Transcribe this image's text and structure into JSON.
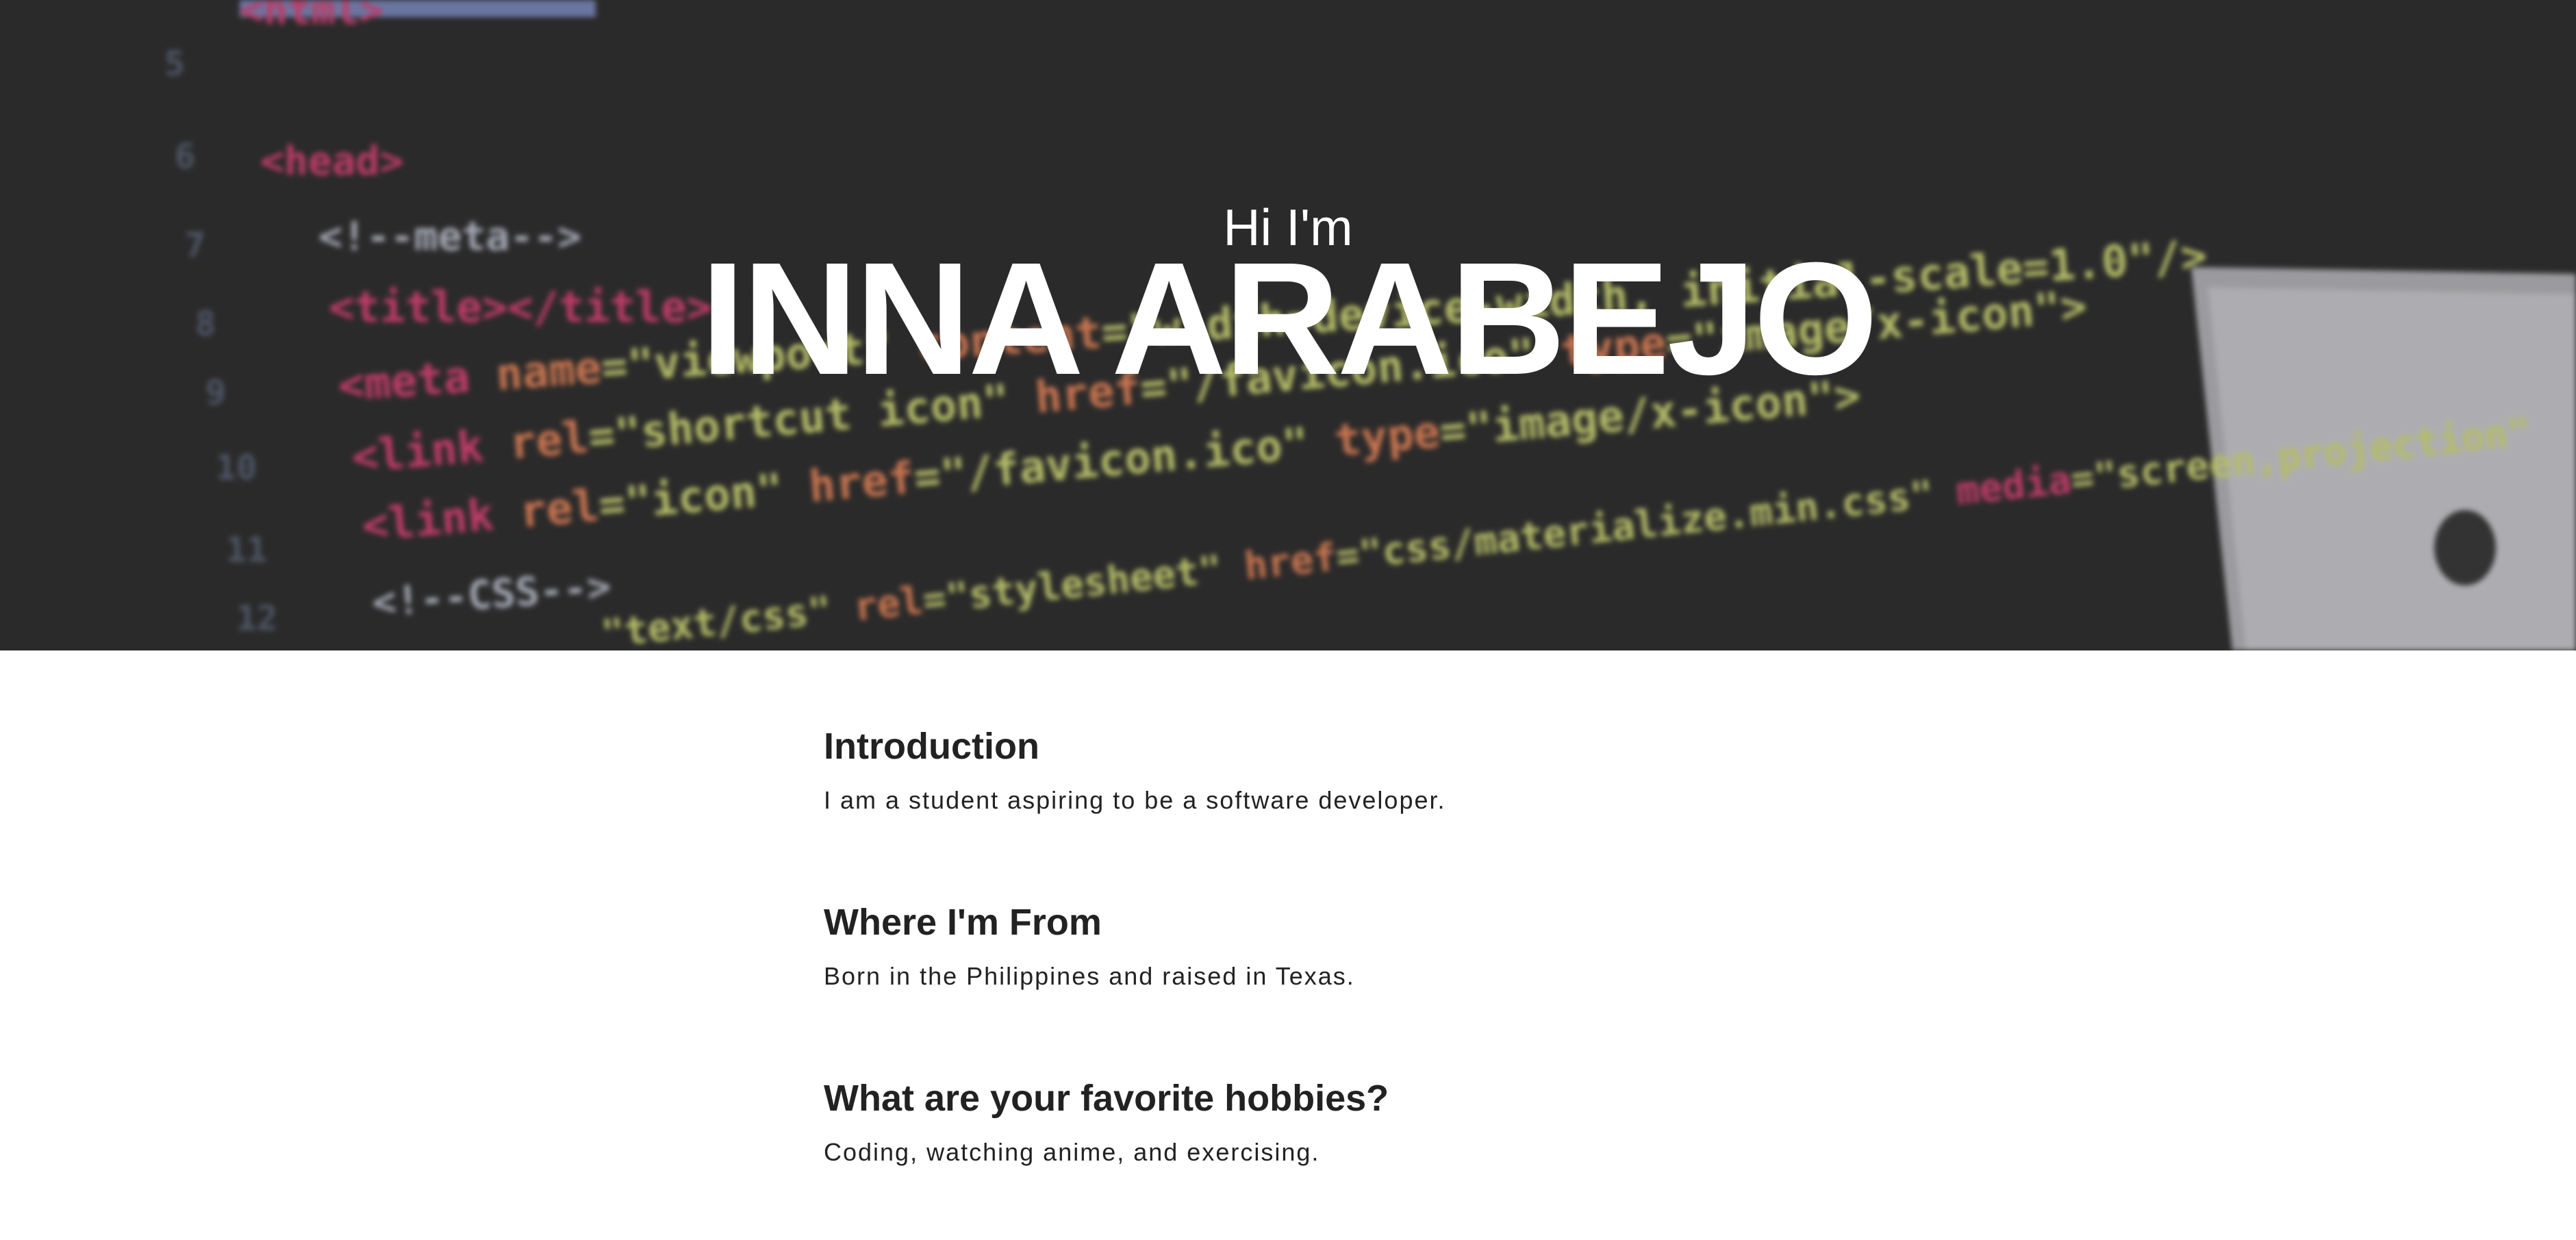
{
  "hero": {
    "greeting": "Hi I'm",
    "name": "INNA ARABEJO",
    "background": "code-screenshot-image"
  },
  "sections": [
    {
      "heading": "Introduction",
      "text": "I am a student aspiring to be a software developer."
    },
    {
      "heading": "Where I'm From",
      "text": "Born in the Philippines and raised in Texas."
    },
    {
      "heading": "What are your favorite hobbies?",
      "text": "Coding, watching anime, and exercising."
    }
  ],
  "colors": {
    "hero_bg": "#2f2f2f",
    "text": "#222222",
    "tag_pink": "#e3457a",
    "attr_orange": "#f08a5d",
    "string_yellow": "#d8e27a"
  }
}
